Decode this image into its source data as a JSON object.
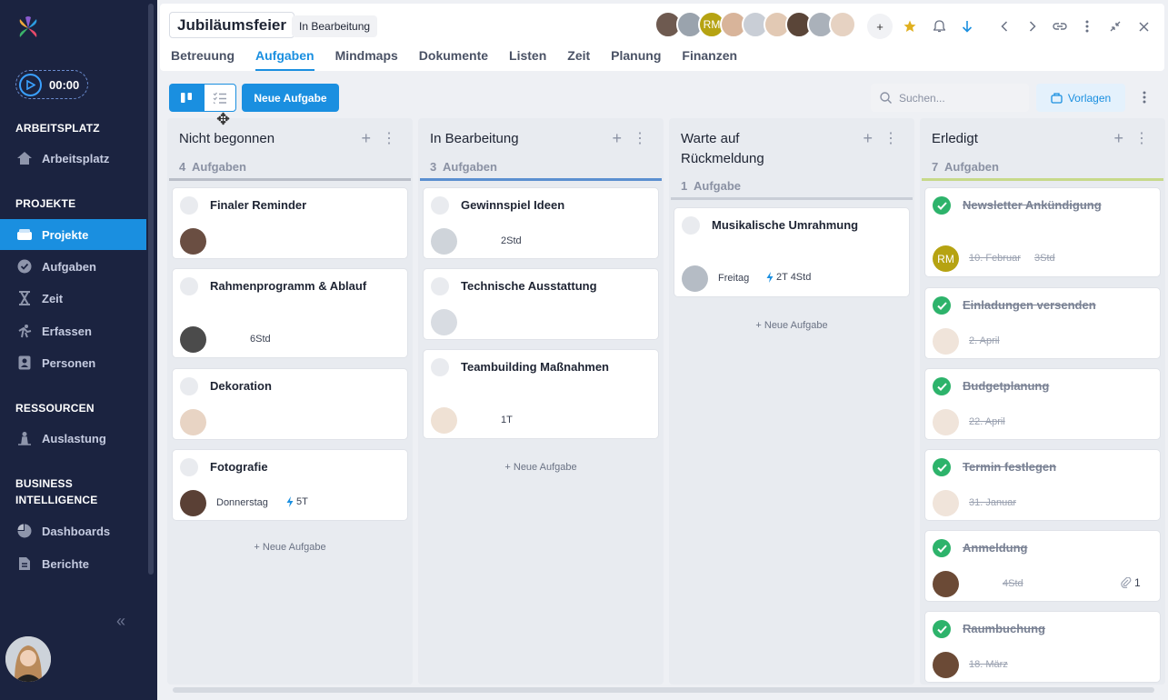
{
  "sidebar": {
    "timer": "00:00",
    "sections": [
      "ARBEITSPLATZ",
      "PROJEKTE",
      "RESSOURCEN",
      "BUSINESS INTELLIGENCE"
    ],
    "items": [
      {
        "label": "Arbeitsplatz",
        "icon": "home-icon"
      },
      {
        "label": "Projekte",
        "icon": "projects-icon"
      },
      {
        "label": "Aufgaben",
        "icon": "check-circle-icon"
      },
      {
        "label": "Zeit",
        "icon": "hourglass-icon"
      },
      {
        "label": "Erfassen",
        "icon": "run-icon"
      },
      {
        "label": "Personen",
        "icon": "person-card-icon"
      },
      {
        "label": "Auslastung",
        "icon": "workload-icon"
      },
      {
        "label": "Dashboards",
        "icon": "pie-chart-icon"
      },
      {
        "label": "Berichte",
        "icon": "report-icon"
      }
    ],
    "collapse": "«",
    "accent": "#1a8fe0"
  },
  "header": {
    "project_title": "Jubiläumsfeier",
    "project_status": "In Bearbeitung",
    "tabs": [
      "Betreuung",
      "Aufgaben",
      "Mindmaps",
      "Dokumente",
      "Listen",
      "Zeit",
      "Planung",
      "Finanzen"
    ],
    "active_tab": "Aufgaben",
    "member_initials": "RM",
    "add_member": "+"
  },
  "toolbar": {
    "new_task": "Neue Aufgabe",
    "search_placeholder": "Suchen...",
    "templates": "Vorlagen"
  },
  "columns": [
    {
      "title": "Nicht begonnen",
      "count": "4",
      "count_label": "Aufgaben",
      "line_color": "#b9bec8",
      "cards": [
        {
          "title": "Finaler Reminder"
        },
        {
          "title": "Rahmenprogramm & Ablauf",
          "meta": "6Std"
        },
        {
          "title": "Dekoration"
        },
        {
          "title": "Fotografie",
          "date": "Donnerstag",
          "meta": "5T"
        }
      ],
      "add": "Neue Aufgabe"
    },
    {
      "title": "In Bearbeitung",
      "count": "3",
      "count_label": "Aufgaben",
      "line_color": "#5b8fd0",
      "cards": [
        {
          "title": "Gewinnspiel Ideen",
          "meta": "2Std"
        },
        {
          "title": "Technische Ausstattung"
        },
        {
          "title": "Teambuilding Maßnahmen",
          "meta": "1T"
        }
      ],
      "add": "Neue Aufgabe"
    },
    {
      "title": "Warte auf Rückmeldung",
      "count": "1",
      "count_label": "Aufgabe",
      "line_color": "#c9ced7",
      "cards": [
        {
          "title": "Musikalische Umrahmung",
          "date": "Freitag",
          "meta": "2T 4Std"
        }
      ],
      "add": "Neue Aufgabe"
    },
    {
      "title": "Erledigt",
      "count": "7",
      "count_label": "Aufgaben",
      "line_color": "#c7d98a",
      "cards": [
        {
          "title": "Newsletter Ankündigung",
          "avatar_initials": "RM",
          "date": "10. Februar",
          "meta": "3Std"
        },
        {
          "title": "Einladungen versenden",
          "date": "2. April"
        },
        {
          "title": "Budgetplanung",
          "date": "22. April"
        },
        {
          "title": "Termin festlegen",
          "date": "31. Januar"
        },
        {
          "title": "Anmeldung",
          "meta": "4Std",
          "attachments": "1"
        },
        {
          "title": "Raumbuchung",
          "date": "18. März"
        }
      ]
    }
  ]
}
